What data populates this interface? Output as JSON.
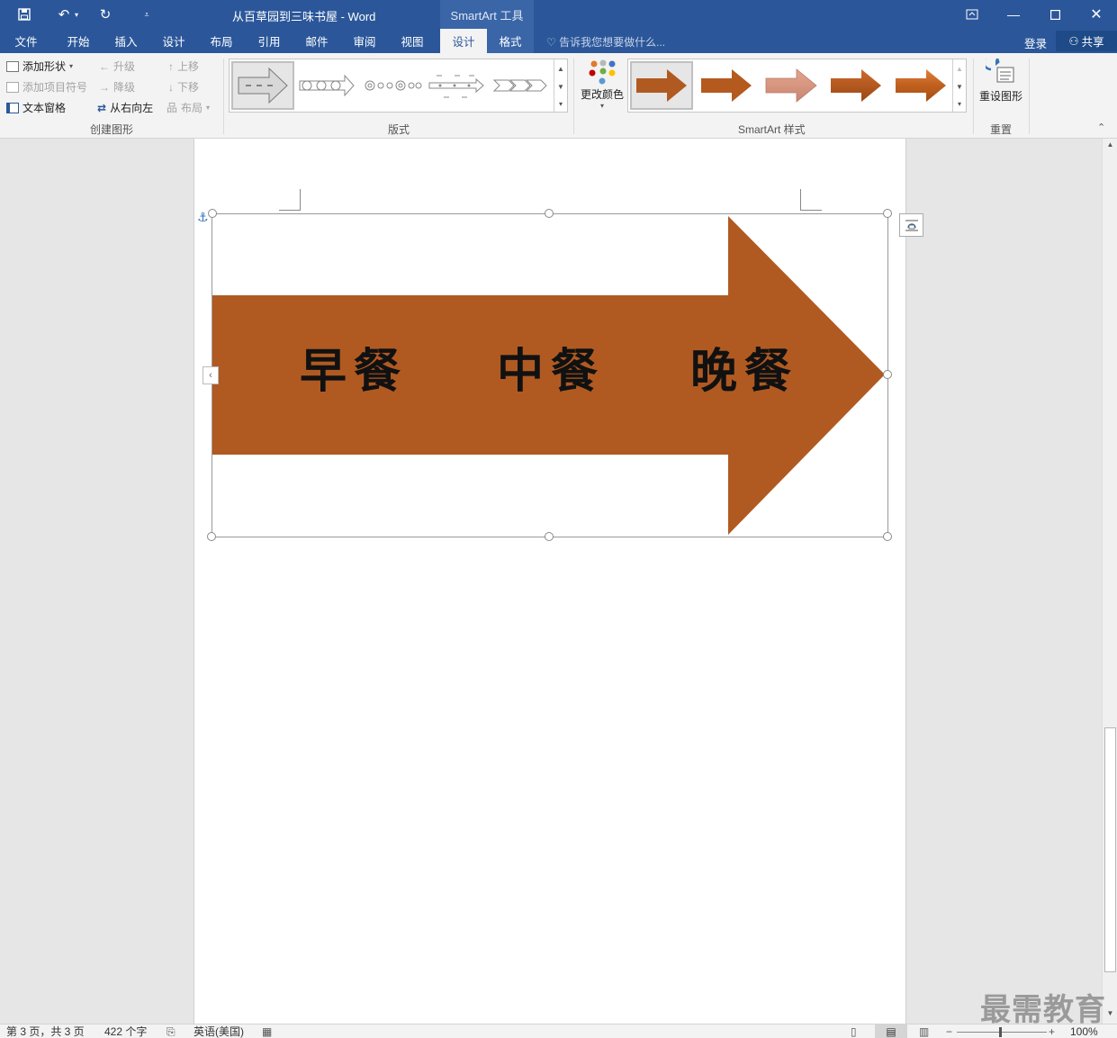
{
  "window": {
    "doc_title": "从百草园到三味书屋 - Word",
    "context_title": "SmartArt 工具"
  },
  "tabs": [
    {
      "label": "文件"
    },
    {
      "label": "开始"
    },
    {
      "label": "插入"
    },
    {
      "label": "设计"
    },
    {
      "label": "布局"
    },
    {
      "label": "引用"
    },
    {
      "label": "邮件"
    },
    {
      "label": "审阅"
    },
    {
      "label": "视图"
    },
    {
      "label": "设计"
    },
    {
      "label": "格式"
    }
  ],
  "tell_me": "告诉我您想要做什么...",
  "account": {
    "signin": "登录",
    "share": "共享"
  },
  "ribbon": {
    "create_graphic": {
      "add_shape": "添加形状",
      "add_bullet": "添加项目符号",
      "text_pane": "文本窗格",
      "promote": "升级",
      "demote": "降级",
      "right_to_left": "从右向左",
      "move_up": "上移",
      "move_down": "下移",
      "layout": "布局",
      "group_label": "创建图形"
    },
    "layouts": {
      "group_label": "版式"
    },
    "styles": {
      "change_colors": "更改颜色",
      "group_label": "SmartArt 样式"
    },
    "reset": {
      "reset_graphic": "重设图形",
      "group_label": "重置"
    }
  },
  "smartart": {
    "labels": [
      "早餐",
      "中餐",
      "晚餐"
    ],
    "fill_color": "#b05a22"
  },
  "statusbar": {
    "page": "第 3 页，共 3 页",
    "words": "422 个字",
    "language": "英语(美国)",
    "zoom": "100%"
  },
  "watermark": "最需教育"
}
